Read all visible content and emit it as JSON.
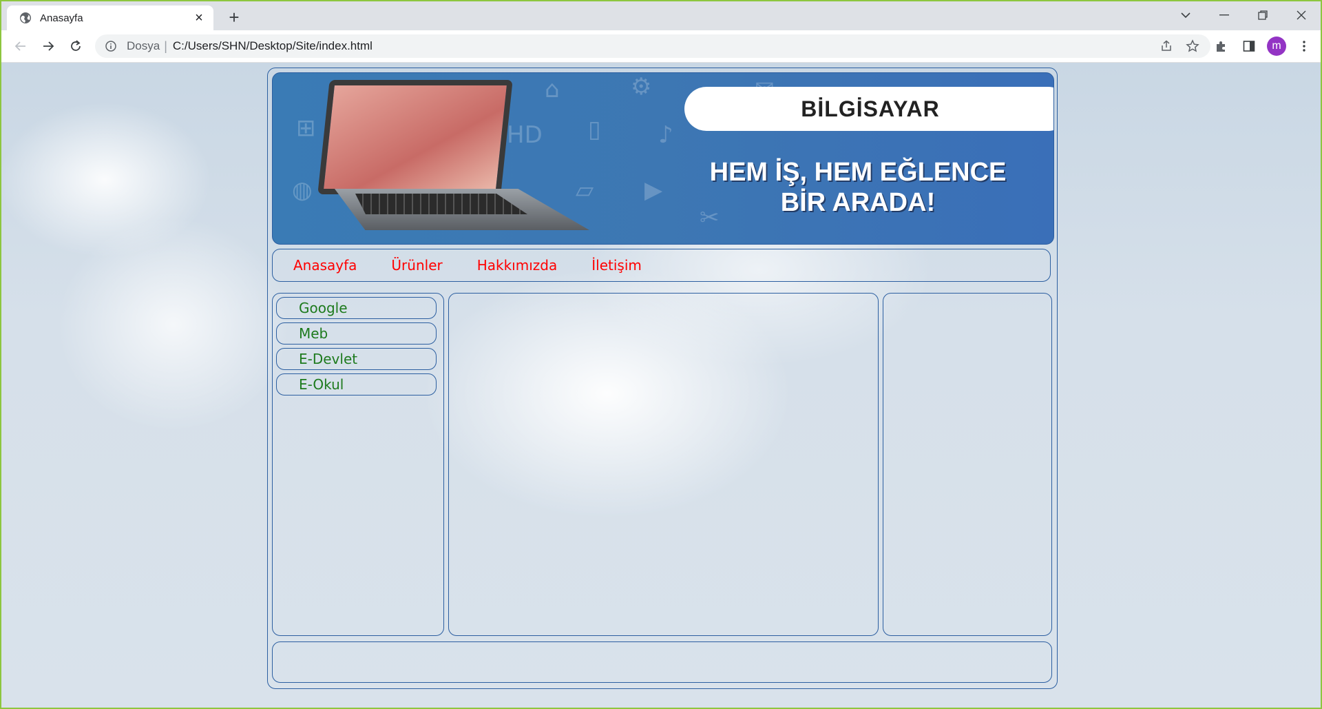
{
  "browser": {
    "tab_title": "Anasayfa",
    "tab_icon": "globe-icon",
    "scheme_label": "Dosya",
    "url": "C:/Users/SHN/Desktop/Site/index.html",
    "profile_initial": "m",
    "profile_color": "#9334c4"
  },
  "banner": {
    "brand": "BİLGİSAYAR",
    "slogan_line1": "HEM İŞ, HEM EĞLENCE",
    "slogan_line2": "BİR ARADA!"
  },
  "nav": {
    "items": [
      {
        "label": "Anasayfa"
      },
      {
        "label": "Ürünler"
      },
      {
        "label": "Hakkımızda"
      },
      {
        "label": "İletişim"
      }
    ],
    "color": "#ff0000"
  },
  "sidebar": {
    "links": [
      {
        "label": "Google"
      },
      {
        "label": "Meb"
      },
      {
        "label": "E-Devlet"
      },
      {
        "label": "E-Okul"
      }
    ],
    "color": "#1d7a1d"
  },
  "theme": {
    "border_color": "#2b5ea0",
    "window_frame": "#8dc63f"
  }
}
